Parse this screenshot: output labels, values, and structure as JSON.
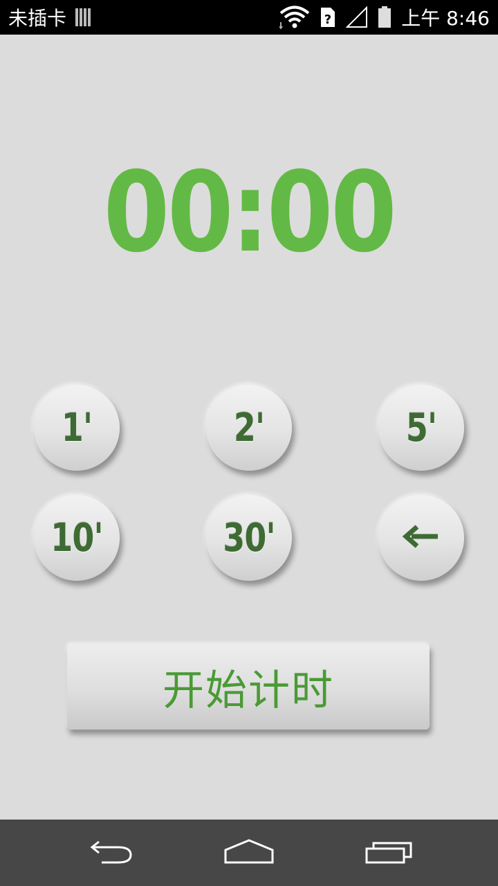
{
  "status_bar": {
    "sim_text": "未插卡",
    "time": "上午 8:46",
    "icons": [
      "sim-bars-icon",
      "wifi-icon",
      "sim-unknown-icon",
      "signal-icon",
      "battery-icon"
    ]
  },
  "timer": {
    "display": "00:00",
    "color": "#63b945"
  },
  "presets": {
    "p1": "1'",
    "p2": "2'",
    "p5": "5'",
    "p10": "10'",
    "p30": "30'",
    "backspace_icon": "arrow-left-icon"
  },
  "start_button": {
    "label": "开始计时",
    "color": "#4a9a35"
  },
  "nav_bar": {
    "icons": [
      "back-icon",
      "home-icon",
      "recents-icon"
    ]
  }
}
